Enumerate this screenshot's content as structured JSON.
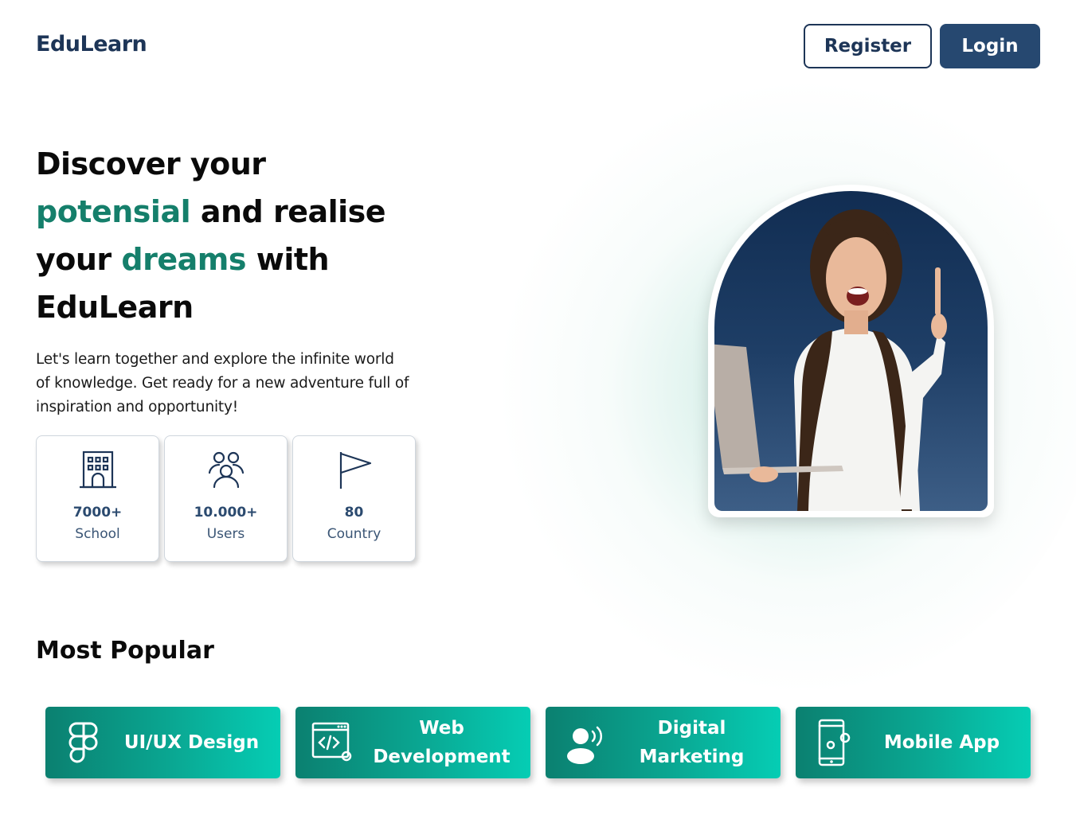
{
  "header": {
    "logo": "EduLearn",
    "register_label": "Register",
    "login_label": "Login"
  },
  "hero": {
    "line1": "Discover  your",
    "line2_highlight": "potensial",
    "line2_rest": " and realise",
    "line3_start": "your ",
    "line3_highlight": "dreams",
    "line3_rest": " with",
    "line4": "EduLearn",
    "description": "Let's learn together and explore the infinite world of knowledge. Get ready for a new adventure full of inspiration and opportunity!"
  },
  "stats": [
    {
      "icon": "building-icon",
      "value": "7000+",
      "label": "School"
    },
    {
      "icon": "users-icon",
      "value": "10.000+",
      "label": "Users"
    },
    {
      "icon": "flag-icon",
      "value": "80",
      "label": "Country"
    }
  ],
  "popular": {
    "title": "Most Popular",
    "items": [
      {
        "icon": "figma-icon",
        "label": "UI/UX Design"
      },
      {
        "icon": "code-window-icon",
        "label": "Web Development"
      },
      {
        "icon": "speaker-person-icon",
        "label": "Digital Marketing"
      },
      {
        "icon": "mobile-gear-icon",
        "label": "Mobile App"
      }
    ]
  },
  "colors": {
    "navy": "#1d3557",
    "button_fill": "#264870",
    "accent_green": "#157f6b",
    "card_gradient_start": "#0b8070",
    "card_gradient_end": "#05cdb4"
  }
}
